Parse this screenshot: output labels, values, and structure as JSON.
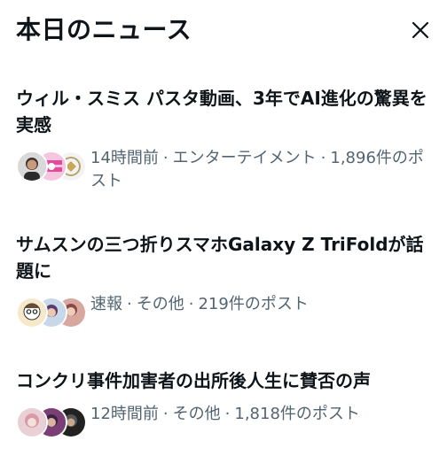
{
  "panel": {
    "title": "本日のニュース",
    "close_icon": "close-icon"
  },
  "news": [
    {
      "headline": "ウィル・スミス パスタ動画、3年でAI進化の驚異を実感",
      "time": "14時間前",
      "category": "エンターテイメント",
      "posts": "1,896件のポスト"
    },
    {
      "headline": "サムスンの三つ折りスマホGalaxy Z TriFoldが話題に",
      "time": "速報",
      "category": "その他",
      "posts": "219件のポスト"
    },
    {
      "headline": "コンクリ事件加害者の出所後人生に賛否の声",
      "time": "12時間前",
      "category": "その他",
      "posts": "1,818件のポスト"
    }
  ],
  "colors": {
    "text_primary": "#0f1419",
    "text_secondary": "#536471",
    "background": "#ffffff"
  }
}
